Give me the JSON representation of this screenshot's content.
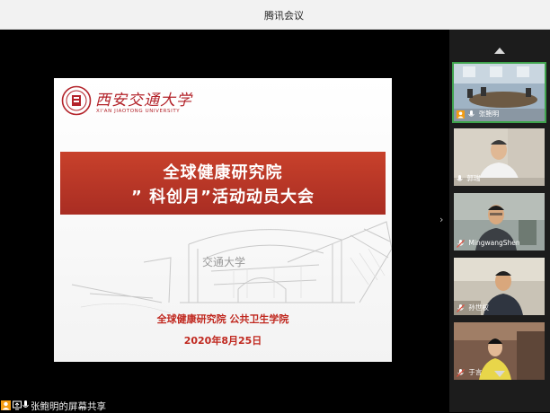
{
  "window": {
    "title": "腾讯会议"
  },
  "slide": {
    "university_cn": "西安交通大学",
    "university_en": "XI'AN JIAOTONG UNIVERSITY",
    "banner_line1": "全球健康研究院",
    "banner_line2": "” 科创月”活动动员大会",
    "organizers": "全球健康研究院  公共卫生学院",
    "date": "2020年8月25日",
    "gate_text": "交通大学"
  },
  "participants": [
    {
      "name": "张鲍明",
      "host": true,
      "mic": "on"
    },
    {
      "name": "郭瑞",
      "host": false,
      "mic": "on"
    },
    {
      "name": "MingwangShen",
      "host": false,
      "mic": "muted"
    },
    {
      "name": "孙世权",
      "host": false,
      "mic": "muted"
    },
    {
      "name": "于言",
      "host": false,
      "mic": "muted"
    }
  ],
  "status": {
    "share_text": "张鲍明的屏幕共享"
  },
  "colors": {
    "accent_red": "#c0392b",
    "sidebar_bg": "#1c1c1c",
    "titlebar_bg": "#f2f2f2"
  }
}
